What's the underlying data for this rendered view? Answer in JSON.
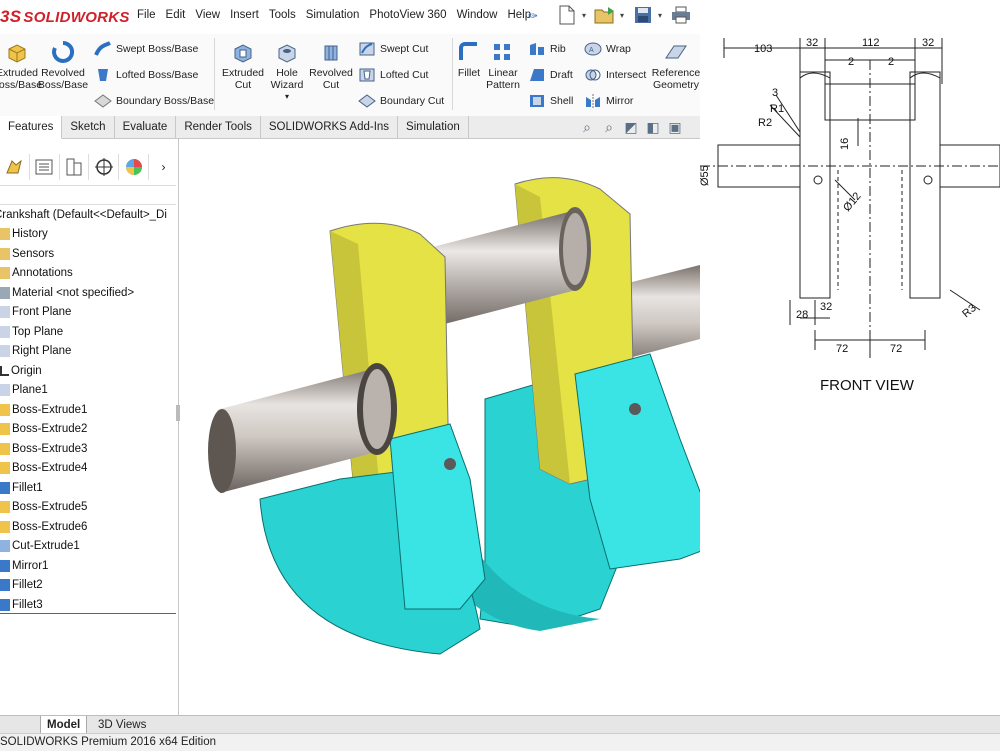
{
  "app": {
    "logo_text": "SOLIDWORKS",
    "status_bar": "SOLIDWORKS Premium 2016 x64 Edition"
  },
  "menu": [
    "File",
    "Edit",
    "View",
    "Insert",
    "Tools",
    "Simulation",
    "PhotoView 360",
    "Window",
    "Help"
  ],
  "ribbon": {
    "extruded_boss": "Extruded\nBoss/Base",
    "revolved_boss": "Revolved\nBoss/Base",
    "swept_boss": "Swept Boss/Base",
    "lofted_boss": "Lofted Boss/Base",
    "boundary_boss": "Boundary Boss/Base",
    "extruded_cut": "Extruded\nCut",
    "hole_wizard": "Hole\nWizard",
    "revolved_cut": "Revolved\nCut",
    "swept_cut": "Swept Cut",
    "lofted_cut": "Lofted Cut",
    "boundary_cut": "Boundary Cut",
    "fillet": "Fillet",
    "linear_pattern": "Linear\nPattern",
    "rib": "Rib",
    "draft": "Draft",
    "shell": "Shell",
    "wrap": "Wrap",
    "intersect": "Intersect",
    "mirror": "Mirror",
    "reference_geometry": "Reference\nGeometry"
  },
  "command_tabs": [
    "Features",
    "Sketch",
    "Evaluate",
    "Render Tools",
    "SOLIDWORKS Add-Ins",
    "Simulation"
  ],
  "feature_tree": {
    "root": "Crankshaft  (Default<<Default>_Di",
    "items": [
      "History",
      "Sensors",
      "Annotations",
      "Material <not specified>",
      "Front Plane",
      "Top Plane",
      "Right Plane",
      "Origin",
      "Plane1",
      "Boss-Extrude1",
      "Boss-Extrude2",
      "Boss-Extrude3",
      "Boss-Extrude4",
      "Fillet1",
      "Boss-Extrude5",
      "Boss-Extrude6",
      "Cut-Extrude1",
      "Mirror1",
      "Fillet2",
      "Fillet3"
    ]
  },
  "bottom_tabs": [
    "Model",
    "3D Views"
  ],
  "drawing": {
    "title": "FRONT VIEW",
    "dims": {
      "d103": "103",
      "d32a": "32",
      "d112": "112",
      "d32b": "32",
      "d2a": "2",
      "d2b": "2",
      "d3": "3",
      "r1": "R1",
      "r2": "R2",
      "d16": "16",
      "dia55": "Ø55",
      "dia12": "Ø12",
      "r3": "R3",
      "d28": "28",
      "d32c": "32",
      "d72a": "72",
      "d72b": "72"
    }
  },
  "colors": {
    "web_yellow": "#e4e245",
    "counterweight_cyan": "#2bd2d2",
    "shaft_grey": "#b9b2ad",
    "logo_red": "#d0202a"
  }
}
